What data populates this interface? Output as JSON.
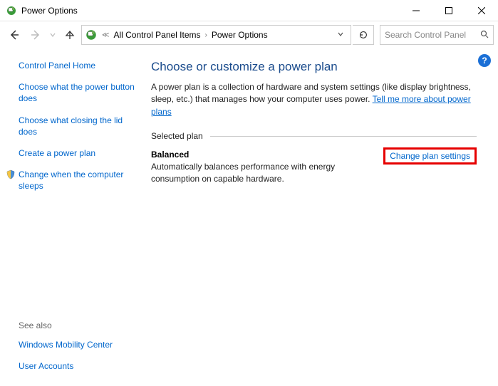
{
  "window": {
    "title": "Power Options"
  },
  "breadcrumb": {
    "items": [
      "All Control Panel Items",
      "Power Options"
    ]
  },
  "search": {
    "placeholder": "Search Control Panel"
  },
  "help": {
    "label": "?"
  },
  "sidebar": {
    "home": "Control Panel Home",
    "links": [
      "Choose what the power button does",
      "Choose what closing the lid does",
      "Create a power plan",
      "Change when the computer sleeps"
    ],
    "see_also_label": "See also",
    "see_also": [
      "Windows Mobility Center",
      "User Accounts"
    ]
  },
  "main": {
    "heading": "Choose or customize a power plan",
    "description": "A power plan is a collection of hardware and system settings (like display brightness, sleep, etc.) that manages how your computer uses power. ",
    "learn_more": "Tell me more about power plans",
    "selected_label": "Selected plan",
    "plan": {
      "name": "Balanced",
      "description": "Automatically balances performance with energy consumption on capable hardware.",
      "change_link": "Change plan settings"
    }
  }
}
